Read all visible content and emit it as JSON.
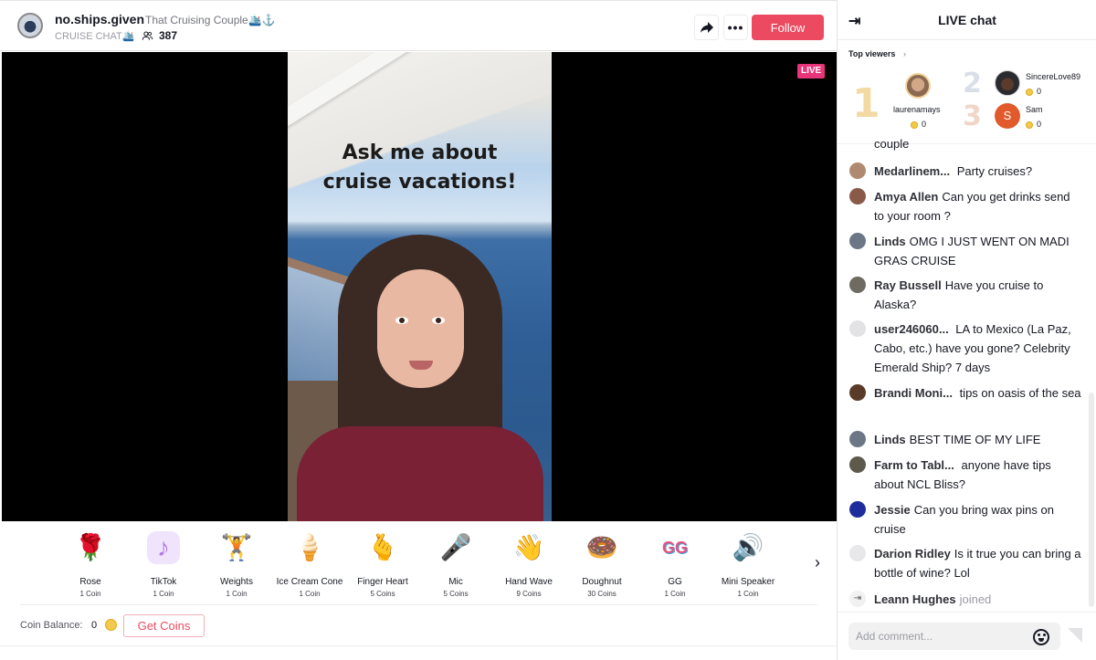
{
  "header": {
    "host_name": "no.ships.given",
    "host_nickname": "That Cruising Couple🛳️⚓",
    "room_title": "CRUISE CHAT🛳️",
    "viewer_count": "387",
    "follow_label": "Follow",
    "more_label": "•••"
  },
  "video": {
    "live_badge": "LIVE",
    "overlay_text_line1": "Ask me about",
    "overlay_text_line2": "cruise vacations!"
  },
  "gifts": {
    "items": [
      {
        "name": "Rose",
        "price": "1 Coin",
        "icon": "rose-icon",
        "glyph": "🌹"
      },
      {
        "name": "TikTok",
        "price": "1 Coin",
        "icon": "tiktok-icon",
        "glyph": "♪"
      },
      {
        "name": "Weights",
        "price": "1 Coin",
        "icon": "weights-icon",
        "glyph": "🏋"
      },
      {
        "name": "Ice Cream Cone",
        "price": "1 Coin",
        "icon": "ice-cream-icon",
        "glyph": "🍦"
      },
      {
        "name": "Finger Heart",
        "price": "5 Coins",
        "icon": "finger-heart-icon",
        "glyph": "🫰"
      },
      {
        "name": "Mic",
        "price": "5 Coins",
        "icon": "mic-icon",
        "glyph": "🎤"
      },
      {
        "name": "Hand Wave",
        "price": "9 Coins",
        "icon": "hand-wave-icon",
        "glyph": "👋"
      },
      {
        "name": "Doughnut",
        "price": "30 Coins",
        "icon": "doughnut-icon",
        "glyph": "🍩"
      },
      {
        "name": "GG",
        "price": "1 Coin",
        "icon": "gg-icon",
        "glyph": "GG"
      },
      {
        "name": "Mini Speaker",
        "price": "1 Coin",
        "icon": "speaker-icon",
        "glyph": "🔊"
      }
    ],
    "next_label": "›"
  },
  "coins": {
    "label": "Coin Balance:",
    "balance": "0",
    "get_coins_label": "Get Coins"
  },
  "chat": {
    "title": "LIVE chat",
    "top_viewers_label": "Top viewers",
    "top_viewers": [
      {
        "rank": "1",
        "name": "laurenamays",
        "score": "0"
      },
      {
        "rank": "2",
        "name": "SincereLove89",
        "score": "0"
      },
      {
        "rank": "3",
        "name": "Sam",
        "initial": "S",
        "score": "0"
      }
    ],
    "partial_message": "couple",
    "messages": [
      {
        "user": "Medarlinem...",
        "text": " Party cruises?",
        "avatar_color": "#b08a70"
      },
      {
        "user": "Amya Allen",
        "text": "Can you get drinks send to your room ?",
        "avatar_color": "#8a5a48"
      },
      {
        "user": "Linds",
        "text": "OMG I JUST WENT ON MADI GRAS CRUISE",
        "avatar_color": "#6b7785"
      },
      {
        "user": "Ray Bussell",
        "text": "Have you cruise to Alaska?",
        "avatar_color": "#6f6a62"
      },
      {
        "user": "user246060...",
        "text": " LA to Mexico (La Paz, Cabo, etc.) have you gone? Celebrity Emerald Ship? 7 days",
        "avatar_color": "#e3e3e6"
      },
      {
        "user": "Brandi Moni...",
        "text": " tips on oasis of the sea",
        "avatar_color": "#5a3a28"
      },
      {
        "user": "Linds",
        "text": "BEST TIME OF MY LIFE",
        "avatar_color": "#6b7785"
      },
      {
        "user": "Farm to Tabl...",
        "text": " anyone have tips about NCL Bliss?",
        "avatar_color": "#5d5a4c"
      },
      {
        "user": "Jessie",
        "text": "Can you bring wax pins on cruise",
        "avatar_color": "#1f2d9c"
      },
      {
        "user": "Darion Ridley",
        "text": "Is it true you can bring a bottle of wine? Lol",
        "avatar_color": "#e8e8ea"
      }
    ],
    "join_event": {
      "user": "Leann Hughes",
      "text": "joined"
    },
    "input_placeholder": "Add comment..."
  }
}
